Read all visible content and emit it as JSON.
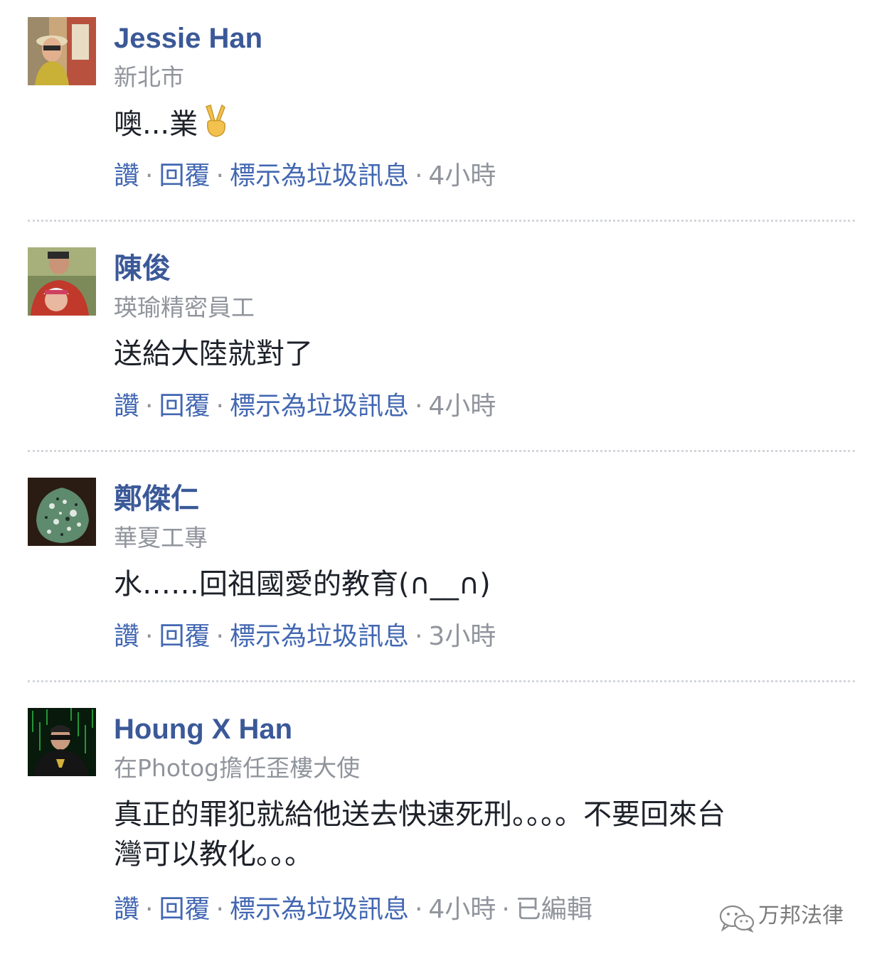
{
  "comments": [
    {
      "name": "Jessie Han",
      "subtitle": "新北市",
      "text": "噢...業",
      "emoji": "victory-hand-emoji",
      "actions": {
        "like": "讚",
        "reply": "回覆",
        "spam": "標示為垃圾訊息",
        "time": "4小時"
      }
    },
    {
      "name": "陳俊",
      "subtitle": "瑛瑜精密員工",
      "text": "送給大陸就對了",
      "actions": {
        "like": "讚",
        "reply": "回覆",
        "spam": "標示為垃圾訊息",
        "time": "4小時"
      }
    },
    {
      "name": "鄭傑仁",
      "subtitle": "華夏工專",
      "text": "水……回祖國愛的教育(∩__∩)",
      "actions": {
        "like": "讚",
        "reply": "回覆",
        "spam": "標示為垃圾訊息",
        "time": "3小時"
      }
    },
    {
      "name": "Houng X Han",
      "subtitle": "在Photog擔任歪樓大使",
      "text_line1": "真正的罪犯就給他送去快速死刑。。。。不要回來台",
      "text_line2": "灣可以教化。。。",
      "actions": {
        "like": "讚",
        "reply": "回覆",
        "spam": "標示為垃圾訊息",
        "time": "4小時",
        "edited": "已編輯"
      }
    }
  ],
  "separator": "·",
  "watermark": {
    "text": "万邦法律",
    "icon": "wechat-icon"
  },
  "colors": {
    "name": "#3b5998",
    "link": "#4267b2",
    "meta": "#90949c",
    "text": "#1d2129",
    "divider": "#d3d6db"
  }
}
